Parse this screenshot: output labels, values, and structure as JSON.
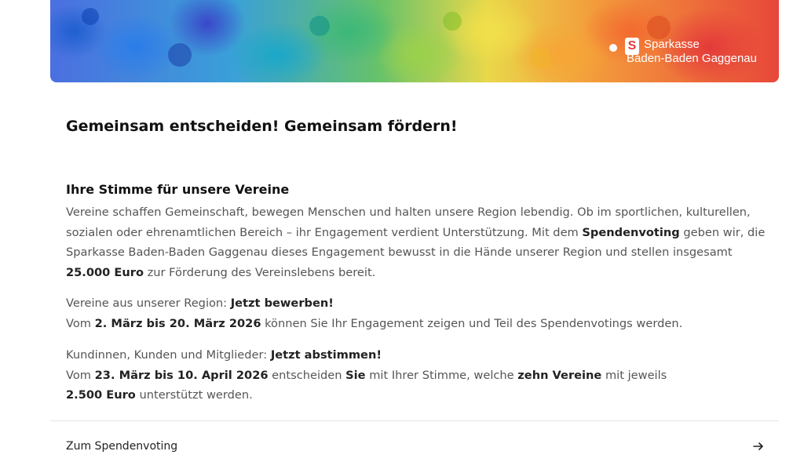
{
  "banner": {
    "brand_line1": "Sparkasse",
    "brand_line2": "Baden-Baden Gaggenau"
  },
  "headline": "Gemeinsam entscheiden! Gemeinsam fördern!",
  "section_title": "Ihre Stimme für unsere Vereine",
  "para1": {
    "t1": "Vereine schaffen Gemeinschaft, bewegen Menschen und halten unsere Region lebendig. Ob im sportlichen, kulturellen, sozialen oder ehrenamtlichen Bereich – ihr Engagement verdient Unterstützung. Mit dem ",
    "b1": "Spendenvoting",
    "t2": " geben wir, die Sparkasse Baden-Baden Gaggenau dieses Engagement bewusst in die Hände unserer Region und stellen insgesamt ",
    "b2": "25.000 Euro",
    "t3": " zur Förderung des Vereinslebens bereit."
  },
  "para2": {
    "t1": "Vereine aus unserer Region: ",
    "b1": "Jetzt bewerben!",
    "t2": "Vom ",
    "b2": "2. März bis 20. März 2026",
    "t3": " können Sie Ihr Engagement zeigen und Teil des Spendenvotings werden."
  },
  "para3": {
    "t1": "Kundinnen, Kunden und Mitglieder: ",
    "b1": "Jetzt abstimmen!",
    "t2": "Vom ",
    "b2": "23. März bis 10. April 2026",
    "t3": " entscheiden ",
    "b3": "Sie",
    "t4": " mit Ihrer Stimme, welche ",
    "b4": "zehn Vereine",
    "t5": " mit jeweils ",
    "b5": "2.500 Euro",
    "t6": " unterstützt werden."
  },
  "cta": {
    "label": "Zum Spendenvoting",
    "icon": "arrow-right-icon"
  },
  "colors": {
    "brand_red": "#e43a3a",
    "text_muted": "#555555",
    "text_strong": "#222222"
  }
}
